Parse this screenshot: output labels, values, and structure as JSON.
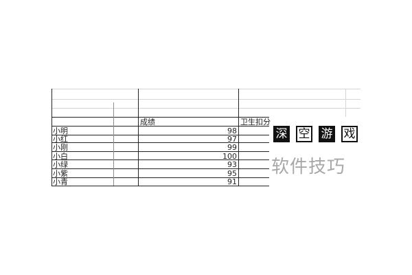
{
  "sheet": {
    "headers": {
      "score": "成绩",
      "hygiene": "卫生扣分"
    },
    "rows": [
      {
        "name": "小明",
        "score": "98"
      },
      {
        "name": "小红",
        "score": "97"
      },
      {
        "name": "小刚",
        "score": "99"
      },
      {
        "name": "小白",
        "score": "100"
      },
      {
        "name": "小绿",
        "score": "93"
      },
      {
        "name": "小紫",
        "score": "95"
      },
      {
        "name": "小青",
        "score": "91"
      }
    ]
  },
  "watermark": {
    "characters": [
      "深",
      "空",
      "游",
      "戏"
    ],
    "caption": "软件技巧"
  }
}
